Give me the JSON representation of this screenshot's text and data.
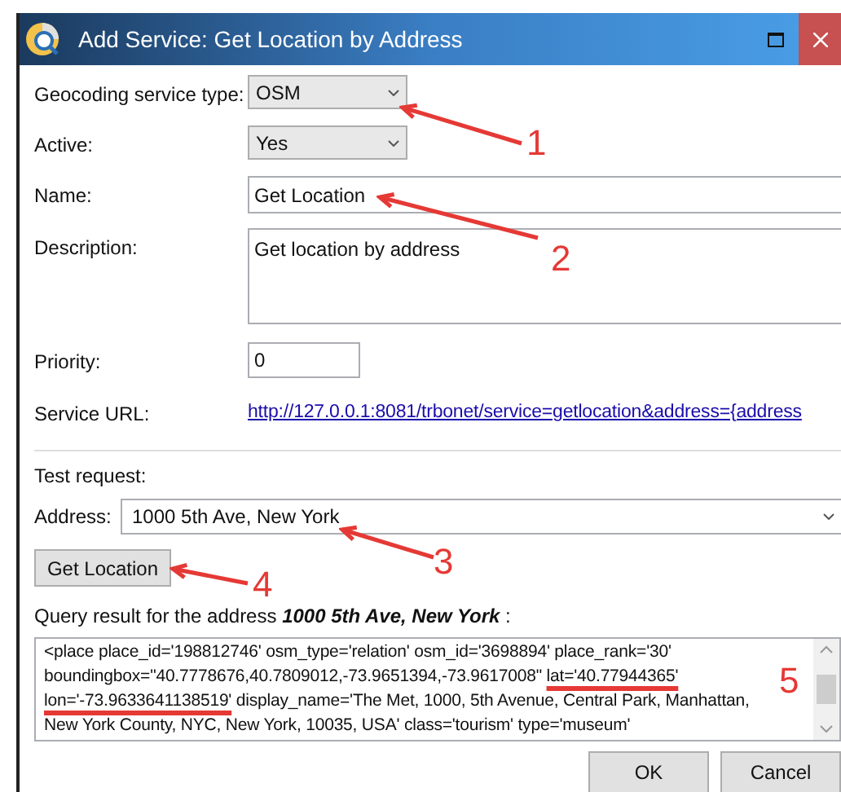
{
  "window": {
    "title": "Add Service: Get Location by Address"
  },
  "form": [
    {
      "kind": "select",
      "label": "Geocoding service type:",
      "value": "OSM"
    },
    {
      "kind": "select",
      "label": "Active:",
      "value": "Yes"
    },
    {
      "kind": "text",
      "label": "Name:",
      "value": "Get Location"
    },
    {
      "kind": "textarea",
      "label": "Description:",
      "value": "Get location by address"
    },
    {
      "kind": "number",
      "label": "Priority:",
      "value": "0"
    },
    {
      "kind": "link",
      "label": "Service URL:",
      "value": "http://127.0.0.1:8081/trbonet/service=getlocation&address={address"
    }
  ],
  "test_request": {
    "title": "Test request:",
    "address_label": "Address:",
    "address_value": "1000 5th Ave, New York",
    "button": "Get Location",
    "result_label": "Query result for the address *1000 5th Ave, New York* :",
    "result": [
      {
        "text": "<place place_id='198812746' osm_type='relation' osm_id='3698894' place_rank='30' boundingbox=\"40.7778676,40.7809012,-73.9651394,-73.9617008\"",
        "highlighted": false
      },
      {
        "text": "lat='40.77944365'",
        "highlighted": true
      },
      {
        "text": "lon='-73.9633641138519'",
        "highlighted": true
      },
      {
        "text": "display_name='The Met, 1000, 5th Avenue, Central Park, Manhattan, New York County, NYC, New York, 10035, USA' class='tourism' type='museum'",
        "highlighted": false
      }
    ]
  },
  "buttons": [
    "OK",
    "Cancel"
  ],
  "annotations": [
    "1",
    "2",
    "3",
    "4",
    "5"
  ]
}
